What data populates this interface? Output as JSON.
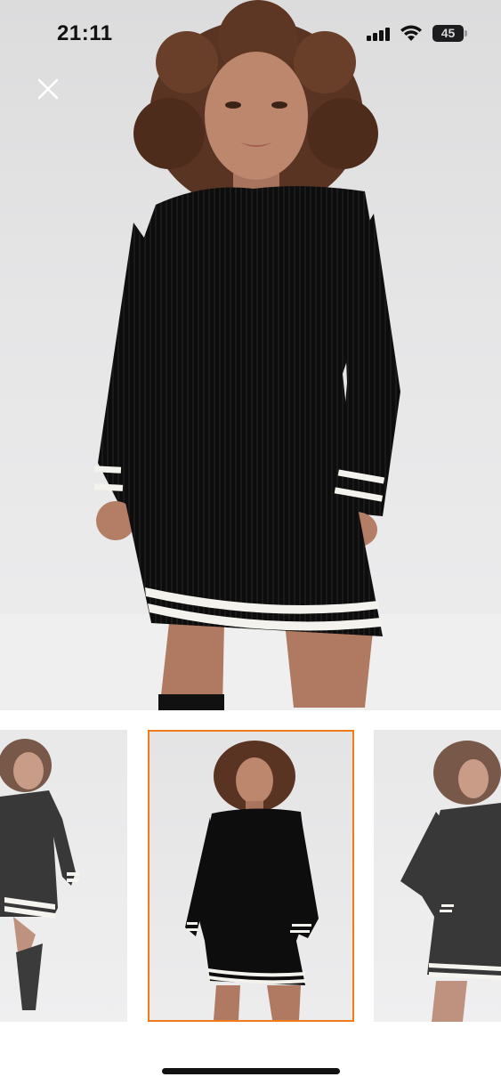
{
  "status_bar": {
    "time": "21:11",
    "battery_level": "45",
    "icons": [
      "cellular-signal-icon",
      "wifi-icon",
      "battery-icon"
    ]
  },
  "close_button": {
    "icon": "close-icon",
    "color": "#ffffff"
  },
  "gallery": {
    "selected_index": 1,
    "selected_border_color": "#f27a1a",
    "thumbnails": [
      {
        "icon": "product-photo-side-pose"
      },
      {
        "icon": "product-photo-front-pose"
      },
      {
        "icon": "product-photo-hand-on-hip-pose"
      }
    ]
  },
  "colors": {
    "dress": "#0d0d0d",
    "stripe": "#f4f2ec",
    "hair": "#5a3422",
    "skin": "#b8826a",
    "background": "#e6e6e7"
  }
}
